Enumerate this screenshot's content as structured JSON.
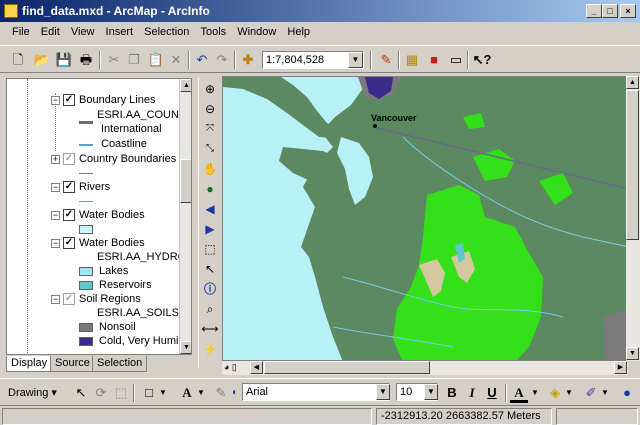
{
  "window": {
    "title": "find_data.mxd - ArcMap - ArcInfo",
    "icon": "arcmap-app-icon"
  },
  "menu": [
    "File",
    "Edit",
    "View",
    "Insert",
    "Selection",
    "Tools",
    "Window",
    "Help"
  ],
  "toolbar": {
    "scale": "1:7,804,528",
    "icons": [
      "new-icon",
      "open-icon",
      "save-icon",
      "print-icon",
      "cut-icon",
      "copy-icon",
      "paste-icon",
      "delete-icon",
      "undo-icon",
      "redo-icon",
      "add-data-icon",
      "editor-icon",
      "arccatalog-icon",
      "arctoolbox-icon",
      "command-line-icon",
      "whats-this-icon"
    ]
  },
  "toc": {
    "items": [
      {
        "label": "Boundary Lines",
        "kind": "layer",
        "checked": true
      },
      {
        "label": "ESRI.AA_COUNTR",
        "kind": "field"
      },
      {
        "label": "International",
        "kind": "legend-line",
        "color": "#6b6b6b"
      },
      {
        "label": "Coastline",
        "kind": "legend-line",
        "color": "#5aa0d8"
      },
      {
        "label": "Country Boundaries",
        "kind": "layer",
        "checked": false
      },
      {
        "label": "Rivers",
        "kind": "layer",
        "checked": true
      },
      {
        "label": "Water Bodies",
        "kind": "layer",
        "checked": true
      },
      {
        "label": "Water Bodies",
        "kind": "layer",
        "checked": true
      },
      {
        "label": "ESRI.AA_HYDRON",
        "kind": "field"
      },
      {
        "label": "Lakes",
        "kind": "legend-fill",
        "color": "#9ee6f0"
      },
      {
        "label": "Reservoirs",
        "kind": "legend-fill",
        "color": "#5ec8c8"
      },
      {
        "label": "Soil Regions",
        "kind": "layer",
        "checked": false
      },
      {
        "label": "ESRI.AA_SOILS_D",
        "kind": "field"
      },
      {
        "label": "Nonsoil",
        "kind": "legend-fill",
        "color": "#7a7a7a"
      },
      {
        "label": "Cold, Very Humid",
        "kind": "legend-fill",
        "color": "#3a2a8a"
      }
    ],
    "tabs": [
      "Display",
      "Source",
      "Selection"
    ],
    "active_tab": "Display"
  },
  "map": {
    "city_label": "Vancouver",
    "colors": {
      "water": "#b8f0f8",
      "land": "#5b8a60",
      "forest": "#33e01a",
      "soil_tan": "#d4c8a0",
      "nonsoil": "#7a7a7a",
      "cold_humid": "#3a2a8a",
      "river": "#7ec8e8",
      "boundary": "#6a6a8a"
    }
  },
  "drawing_toolbar": {
    "drawing_label": "Drawing",
    "font": "Arial",
    "font_size": "10",
    "bold": "B",
    "italic": "I",
    "underline": "U",
    "font_color_letter": "A"
  },
  "status": {
    "coordinates": "-2312913.20  2663382.57 Meters"
  }
}
